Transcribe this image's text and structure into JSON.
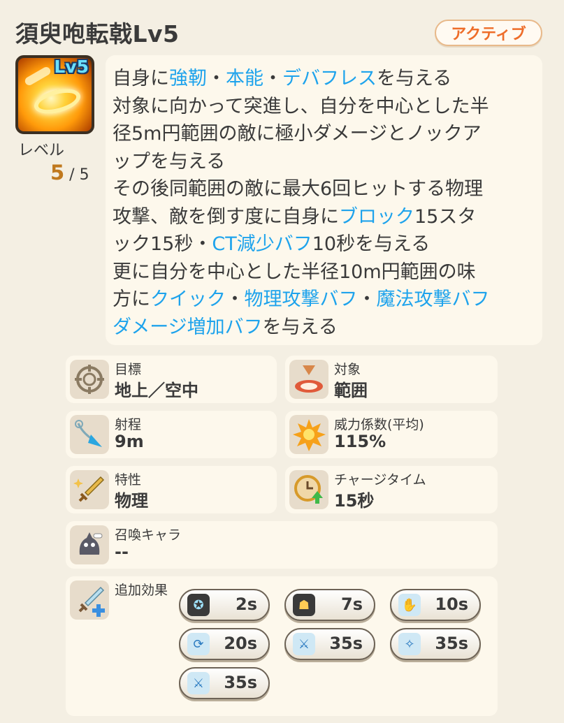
{
  "header": {
    "title": "須臾咆転戟Lv5",
    "badge": "アクティブ"
  },
  "skill": {
    "icon_name": "flame-ring-icon",
    "level_tag": "Lv5",
    "level_label": "レベル",
    "level_current": "5",
    "level_max": " / 5"
  },
  "description": {
    "keyword_color": "#1ea3ec",
    "lines": [
      [
        {
          "t": "自身に"
        },
        {
          "t": "強靭",
          "k": true
        },
        {
          "t": "・"
        },
        {
          "t": "本能",
          "k": true
        },
        {
          "t": "・"
        },
        {
          "t": "デバフレス",
          "k": true
        },
        {
          "t": "を与える"
        }
      ],
      [
        {
          "t": "対象に向かって突進し、自分を中心とした半"
        }
      ],
      [
        {
          "t": "径5m円範囲の敵に極小ダメージとノックア"
        }
      ],
      [
        {
          "t": "ップを与える"
        }
      ],
      [
        {
          "t": "その後同範囲の敵に最大6回ヒットする物理"
        }
      ],
      [
        {
          "t": "攻撃、敵を倒す度に自身に"
        },
        {
          "t": "ブロック",
          "k": true
        },
        {
          "t": "15スタ"
        }
      ],
      [
        {
          "t": "ック15秒・"
        },
        {
          "t": "CT減少バフ",
          "k": true
        },
        {
          "t": "10秒を与える"
        }
      ],
      [
        {
          "t": "更に自分を中心とした半径10m円範囲の味"
        }
      ],
      [
        {
          "t": "方に"
        },
        {
          "t": "クイック",
          "k": true
        },
        {
          "t": "・"
        },
        {
          "t": "物理攻撃バフ",
          "k": true
        },
        {
          "t": "・"
        },
        {
          "t": "魔法攻撃バフ",
          "k": true
        }
      ],
      [
        {
          "t": "ダメージ増加バフ",
          "k": true
        },
        {
          "t": "を与える"
        }
      ]
    ]
  },
  "info": {
    "target": {
      "label": "目標",
      "value": "地上／空中",
      "icon": "crosshair-icon"
    },
    "scope": {
      "label": "対象",
      "value": "範囲",
      "icon": "area-icon"
    },
    "range": {
      "label": "射程",
      "value": "9m",
      "icon": "arrow-icon"
    },
    "power": {
      "label": "威力係数(平均)",
      "value": "115%",
      "icon": "burst-icon"
    },
    "trait": {
      "label": "特性",
      "value": "物理",
      "icon": "sword-icon"
    },
    "charge": {
      "label": "チャージタイム",
      "value": "15秒",
      "icon": "clock-icon"
    },
    "summon": {
      "label": "召喚キャラ",
      "value": "--",
      "icon": "summon-icon"
    },
    "extra": {
      "label": "追加効果",
      "icon": "sword-plus-icon"
    }
  },
  "effects": [
    {
      "name": "effect-toughness",
      "value": "2s",
      "icon": "shield-flex-icon"
    },
    {
      "name": "effect-instinct",
      "value": "7s",
      "icon": "figure-icon"
    },
    {
      "name": "effect-debuffless",
      "value": "10s",
      "icon": "hands-icon"
    },
    {
      "name": "effect-quick",
      "value": "20s",
      "icon": "clock-arrow-icon"
    },
    {
      "name": "effect-phys-atk",
      "value": "35s",
      "icon": "sword-up-icon"
    },
    {
      "name": "effect-mag-atk",
      "value": "35s",
      "icon": "wand-up-icon"
    },
    {
      "name": "effect-dmg-up",
      "value": "35s",
      "icon": "sword-up-icon"
    }
  ]
}
